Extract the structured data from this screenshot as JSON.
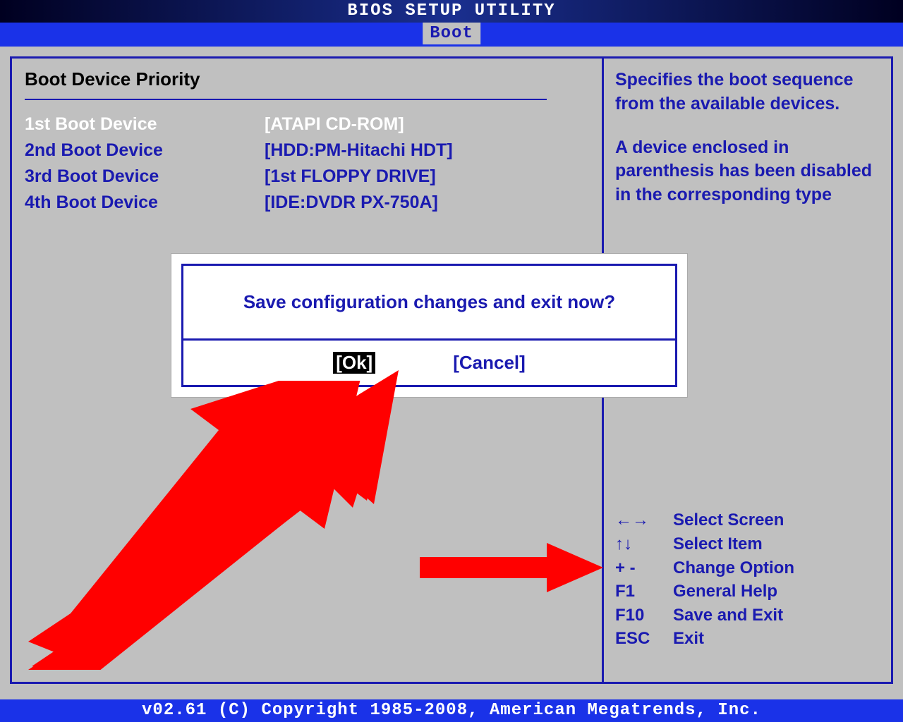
{
  "titlebar": "BIOS SETUP UTILITY",
  "tab": "Boot",
  "section_title": "Boot Device Priority",
  "boot_devices": [
    {
      "label": "1st Boot Device",
      "value": "[ATAPI CD-ROM]",
      "selected": true
    },
    {
      "label": "2nd Boot Device",
      "value": "[HDD:PM-Hitachi HDT]",
      "selected": false
    },
    {
      "label": "3rd Boot Device",
      "value": "[1st FLOPPY DRIVE]",
      "selected": false
    },
    {
      "label": "4th Boot Device",
      "value": "[IDE:DVDR PX-750A]",
      "selected": false
    }
  ],
  "help": {
    "p1": "Specifies the boot sequence from the available devices.",
    "p2": "A device enclosed in parenthesis has been disabled in the corresponding type"
  },
  "keys": [
    {
      "k": "←→",
      "d": "Select Screen"
    },
    {
      "k": "↑↓",
      "d": " Select Item"
    },
    {
      "k": "+ -",
      "d": "Change Option"
    },
    {
      "k": "F1",
      "d": "General Help"
    },
    {
      "k": "F10",
      "d": "Save and Exit"
    },
    {
      "k": "ESC",
      "d": "Exit"
    }
  ],
  "dialog": {
    "message": "Save configuration changes and exit now?",
    "ok": "[Ok]",
    "cancel": "[Cancel]"
  },
  "footer": "v02.61 (C) Copyright 1985-2008, American Megatrends, Inc."
}
